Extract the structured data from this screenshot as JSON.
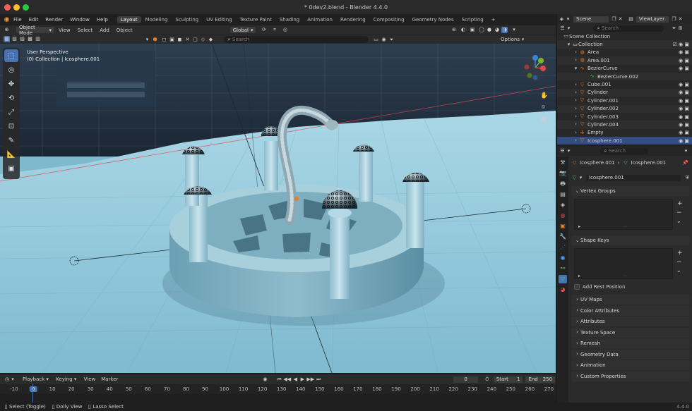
{
  "window": {
    "title": "* 0dev2.blend - Blender 4.4.0"
  },
  "menu": {
    "items": [
      "File",
      "Edit",
      "Render",
      "Window",
      "Help"
    ]
  },
  "workspaces": [
    "Layout",
    "Modeling",
    "Sculpting",
    "UV Editing",
    "Texture Paint",
    "Shading",
    "Animation",
    "Rendering",
    "Compositing",
    "Geometry Nodes",
    "Scripting"
  ],
  "active_workspace": "Layout",
  "header": {
    "mode": "Object Mode",
    "view_menu": [
      "View",
      "Select",
      "Add",
      "Object"
    ],
    "orientation": "Global",
    "options": "Options",
    "search_placeholder": "Search"
  },
  "viewport": {
    "perspective": "User Perspective",
    "collection_info": "(0) Collection | Icosphere.001"
  },
  "top_right": {
    "scene": "Scene",
    "view_layer": "ViewLayer",
    "search_placeholder": "Search"
  },
  "outliner": {
    "root": "Scene Collection",
    "collection": "Collection",
    "items": [
      {
        "name": "Area",
        "type": "light"
      },
      {
        "name": "Area.001",
        "type": "light"
      },
      {
        "name": "BezierCurve",
        "type": "curve"
      },
      {
        "name": "BezierCurve.002",
        "type": "curve-data"
      },
      {
        "name": "Cube.001",
        "type": "mesh"
      },
      {
        "name": "Cylinder",
        "type": "mesh"
      },
      {
        "name": "Cylinder.001",
        "type": "mesh"
      },
      {
        "name": "Cylinder.002",
        "type": "mesh"
      },
      {
        "name": "Cylinder.003",
        "type": "mesh"
      },
      {
        "name": "Cylinder.004",
        "type": "mesh"
      },
      {
        "name": "Empty",
        "type": "empty"
      },
      {
        "name": "Icosphere.001",
        "type": "mesh"
      }
    ]
  },
  "properties": {
    "search_placeholder": "Search",
    "breadcrumb": [
      "Icosphere.001",
      "Icosphere.001"
    ],
    "mesh_name": "Icosphere.001",
    "vertex_groups": "Vertex Groups",
    "shape_keys": "Shape Keys",
    "add_rest_position": "Add Rest Position",
    "panels": [
      "UV Maps",
      "Color Attributes",
      "Attributes",
      "Texture Space",
      "Remesh",
      "Geometry Data",
      "Animation",
      "Custom Properties"
    ]
  },
  "timeline": {
    "menus": [
      "Playback",
      "Keying",
      "View",
      "Marker"
    ],
    "current_frame": "0",
    "start_label": "Start",
    "start": "1",
    "end_label": "End",
    "end": "250",
    "ruler": [
      "-10",
      "0",
      "10",
      "20",
      "30",
      "40",
      "50",
      "60",
      "70",
      "80",
      "90",
      "100",
      "110",
      "120",
      "130",
      "140",
      "150",
      "160",
      "170",
      "180",
      "190",
      "200",
      "210",
      "220",
      "230",
      "240",
      "250",
      "260",
      "270"
    ]
  },
  "status": {
    "select": "Select (Toggle)",
    "dolly": "Dolly View",
    "lasso": "Lasso Select",
    "version": "4.4.0"
  },
  "colors": {
    "accent": "#4772b3",
    "floor": "#7fb9cc",
    "x_axis": "#e0494d",
    "y_axis": "#7ab82a",
    "z_axis": "#3c84d6"
  }
}
